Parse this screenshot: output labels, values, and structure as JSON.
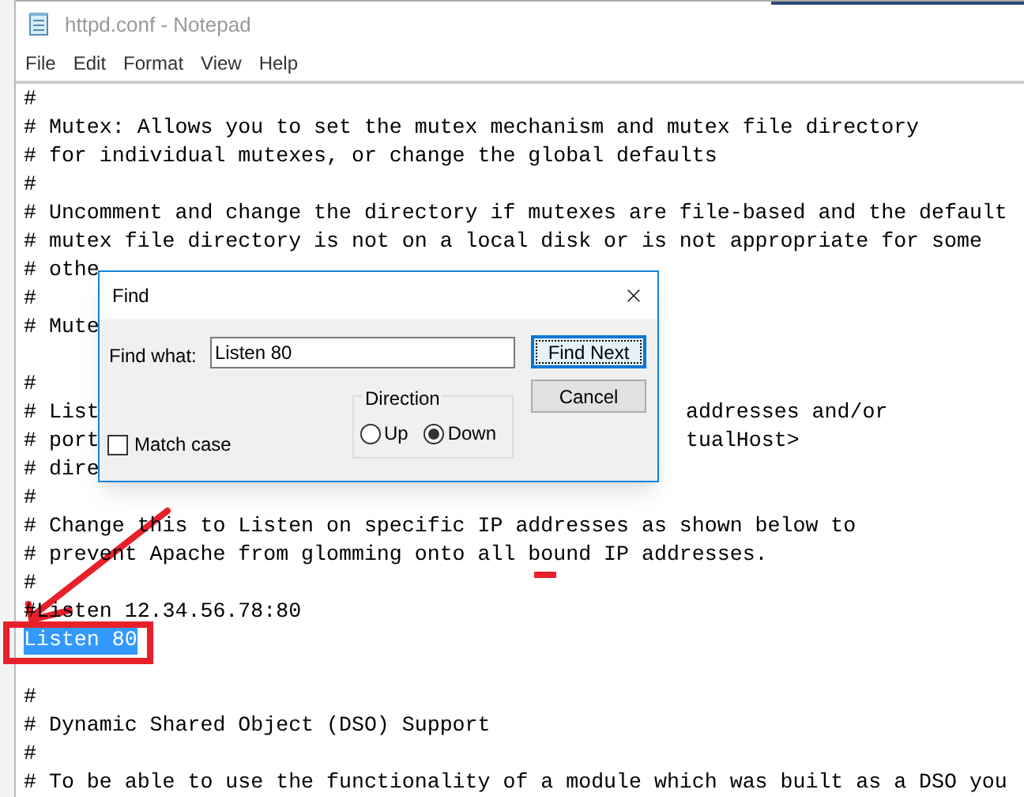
{
  "window": {
    "title": "httpd.conf - Notepad"
  },
  "menu": [
    "File",
    "Edit",
    "Format",
    "View",
    "Help"
  ],
  "lines": [
    {
      "text": "#",
      "selected": false
    },
    {
      "text": "# Mutex: Allows you to set the mutex mechanism and mutex file directory",
      "selected": false
    },
    {
      "text": "# for individual mutexes, or change the global defaults",
      "selected": false
    },
    {
      "text": "#",
      "selected": false
    },
    {
      "text": "# Uncomment and change the directory if mutexes are file-based and the default",
      "selected": false
    },
    {
      "text": "# mutex file directory is not on a local disk or is not appropriate for some",
      "selected": false
    },
    {
      "text": "# othe",
      "selected": false
    },
    {
      "text": "#",
      "selected": false
    },
    {
      "text": "# Mute",
      "selected": false
    },
    {
      "text": "#",
      "selected": false,
      "blank_line_before": true
    },
    {
      "text": "# List",
      "right": "addresses and/or",
      "selected": false
    },
    {
      "text": "# port",
      "right": "tualHost>",
      "selected": false
    },
    {
      "text": "# dire",
      "selected": false
    },
    {
      "text": "#",
      "selected": false
    },
    {
      "text": "# Change this to Listen on specific IP addresses as shown below to",
      "selected": false
    },
    {
      "text": "# prevent Apache from glomming onto all bound IP addresses.",
      "selected": false
    },
    {
      "text": "#",
      "selected": false
    },
    {
      "text": "#Listen 12.34.56.78:80",
      "selected": false
    },
    {
      "text": "Listen 80",
      "selected": true
    },
    {
      "text": "#",
      "selected": false,
      "blank_line_before": true
    },
    {
      "text": "# Dynamic Shared Object (DSO) Support",
      "selected": false
    },
    {
      "text": "#",
      "selected": false
    },
    {
      "text": "# To be able to use the functionality of a module which was built as a DSO you",
      "selected": false
    }
  ],
  "find_dialog": {
    "title": "Find",
    "find_label": "Find what:",
    "find_value": "Listen 80",
    "buttons": [
      {
        "label": "Find Next",
        "focused": true
      },
      {
        "label": "Cancel",
        "focused": false
      }
    ],
    "match_case": {
      "label": "Match case",
      "checked": false
    },
    "direction": {
      "label": "Direction",
      "options": [
        {
          "label": "Up",
          "selected": false
        },
        {
          "label": "Down",
          "selected": true
        }
      ]
    }
  }
}
